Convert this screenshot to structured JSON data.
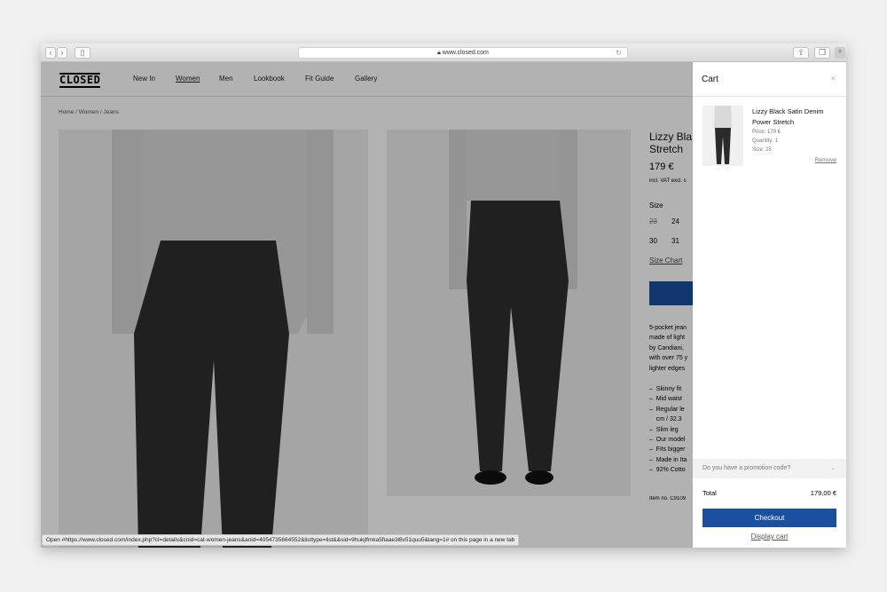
{
  "browser": {
    "url": "www.closed.com",
    "back": "‹",
    "forward": "›"
  },
  "site": {
    "logo": "CLOSED",
    "nav": [
      "New In",
      "Women",
      "Men",
      "Lookbook",
      "Fit Guide",
      "Gallery"
    ],
    "breadcrumb": "Home / Women / Jeans"
  },
  "product": {
    "title_line1": "Lizzy Bla",
    "title_line2": "Stretch",
    "price": "179 €",
    "vat": "incl. VAT excl. s",
    "size_label": "Size",
    "sizes": [
      "23",
      "24",
      "30",
      "31"
    ],
    "size_chart": "Size Chart",
    "description": [
      "5-pocket jean",
      "made of light",
      "by Candiani,",
      "with over 75 y",
      "lighter edges"
    ],
    "features": [
      "Skinny fit",
      "Mid waist",
      "Regular le",
      "cm / 32.3",
      "Slim leg",
      "Our model",
      "Fits bigger",
      "Made in Ita",
      "92% Cotto"
    ],
    "item_no": "Item no. C9109"
  },
  "status_bar": "Open #https://www.closed.com/index.php?cl=details&cnid=cat-women-jeans&anid=4054735664552&listtype=list&&sid=9hukjlfmka5fiaae3l8v51quu5&lang=1# on this page in a new tab",
  "cart": {
    "title": "Cart",
    "close": "×",
    "item": {
      "name": "Lizzy Black Satin Denim Power Stretch",
      "price": "Price: 179 €",
      "quantity": "Quantity: 1",
      "size": "Size: 25",
      "remove": "Remove"
    },
    "promo": "Do you have a promotion code?",
    "total_label": "Total",
    "total_value": "179,00 €",
    "checkout": "Checkout",
    "display_cart": "Display cart"
  },
  "colors": {
    "accent": "#1b4fa0"
  }
}
